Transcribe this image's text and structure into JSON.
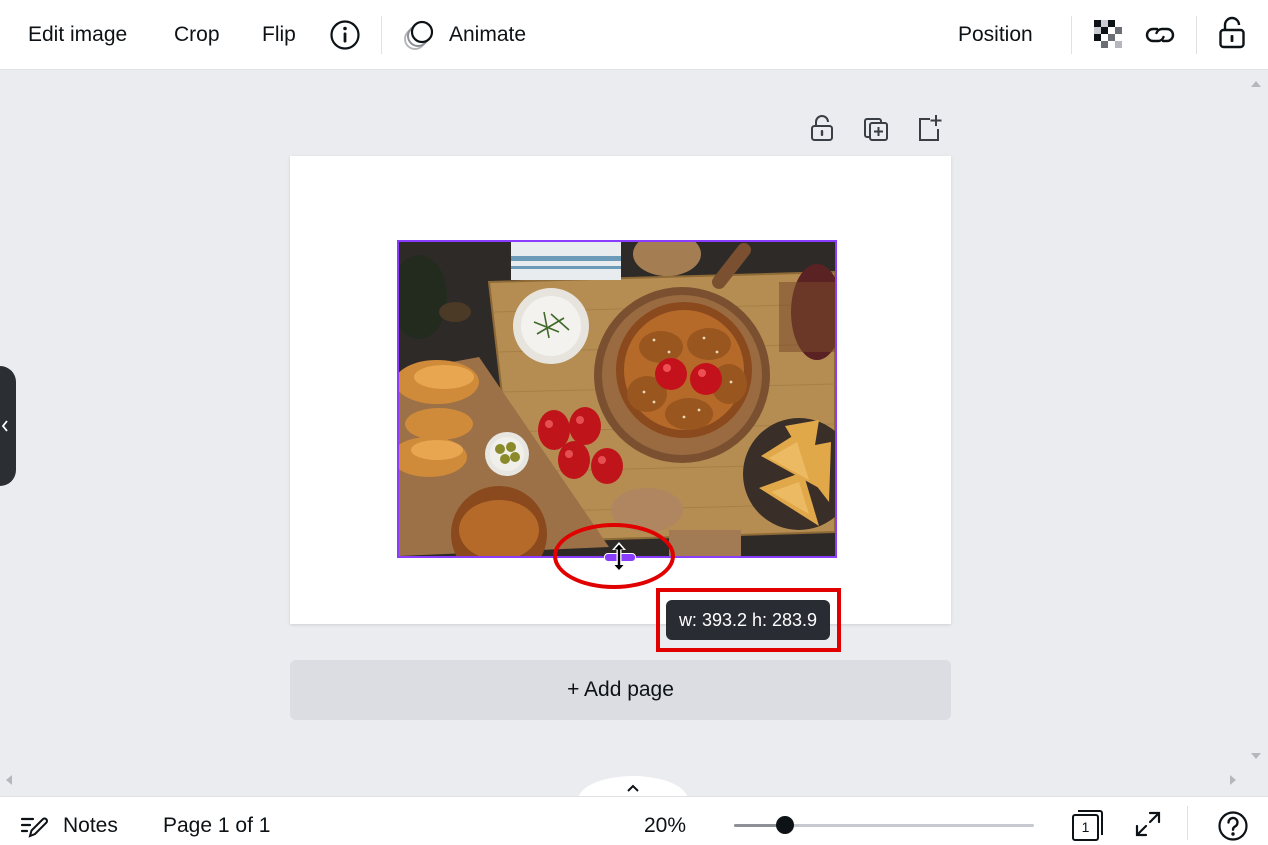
{
  "toolbar": {
    "edit_image": "Edit image",
    "crop": "Crop",
    "flip": "Flip",
    "animate": "Animate",
    "position": "Position"
  },
  "canvas": {
    "dimension_tooltip": "w: 393.2 h: 283.9",
    "add_page": "+ Add page"
  },
  "bottombar": {
    "notes": "Notes",
    "page_indicator": "Page 1 of 1",
    "zoom_label": "20%",
    "zoom_value": 0.17,
    "page_count": "1"
  },
  "colors": {
    "accent": "#8b3dff",
    "annotation": "#e00000",
    "tooltip_bg": "#292c33"
  },
  "icons": [
    "info-icon",
    "animate-icon",
    "transparency-icon",
    "link-icon",
    "lock-icon",
    "duplicate-page-icon",
    "add-page-icon",
    "notes-icon",
    "pages-grid-icon",
    "fullscreen-icon",
    "help-icon",
    "chevron-left-icon",
    "chevron-up-icon",
    "resize-cursor-icon"
  ]
}
